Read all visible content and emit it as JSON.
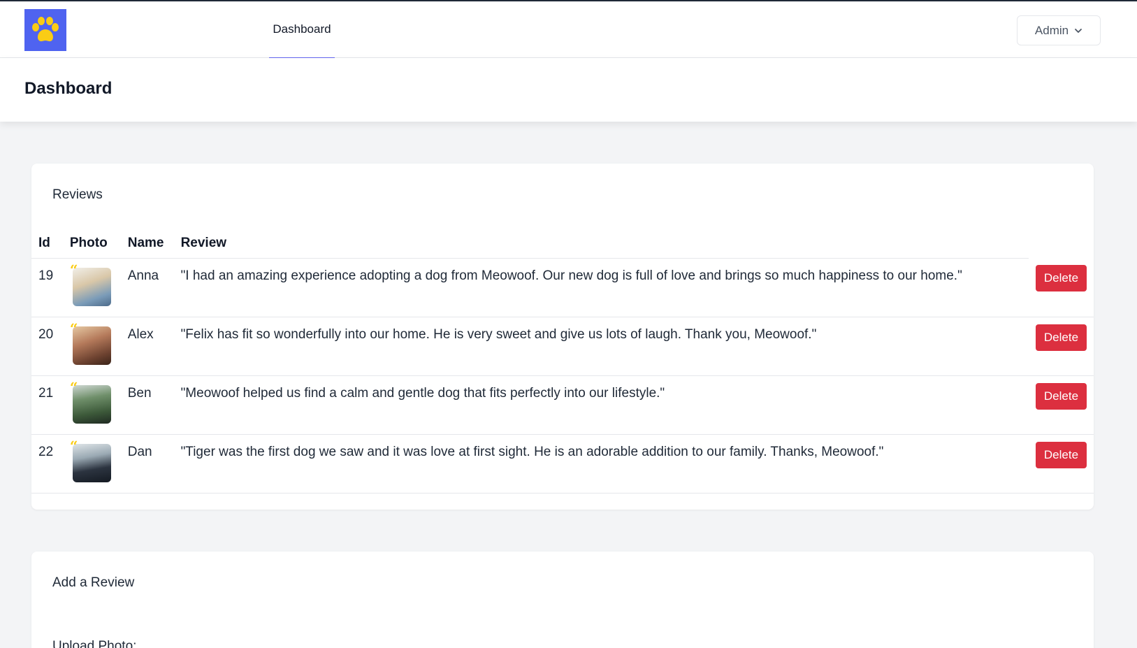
{
  "nav": {
    "tab_label": "Dashboard",
    "admin_label": "Admin"
  },
  "page": {
    "title": "Dashboard"
  },
  "reviews": {
    "title": "Reviews",
    "columns": [
      "Id",
      "Photo",
      "Name",
      "Review"
    ],
    "delete_label": "Delete",
    "rows": [
      {
        "id": "19",
        "name": "Anna",
        "review": "\"I had an amazing experience adopting a dog from Meowoof. Our new dog is full of love and brings so much happiness to our home.\""
      },
      {
        "id": "20",
        "name": "Alex",
        "review": "\"Felix has fit so wonderfully into our home. He is very sweet and give us lots of laugh. Thank you, Meowoof.\""
      },
      {
        "id": "21",
        "name": "Ben",
        "review": "\"Meowoof helped us find a calm and gentle dog that fits perfectly into our lifestyle.\""
      },
      {
        "id": "22",
        "name": "Dan",
        "review": "\"Tiger was the first dog we saw and it was love at first sight. He is an adorable addition to our family. Thanks, Meowoof.\""
      }
    ]
  },
  "add_review": {
    "title": "Add a Review",
    "upload_label": "Upload Photo:"
  },
  "colors": {
    "logo_bg": "#4f63f0",
    "paw": "#facc15",
    "accent": "#6366f1",
    "delete": "#dc2f3f"
  }
}
